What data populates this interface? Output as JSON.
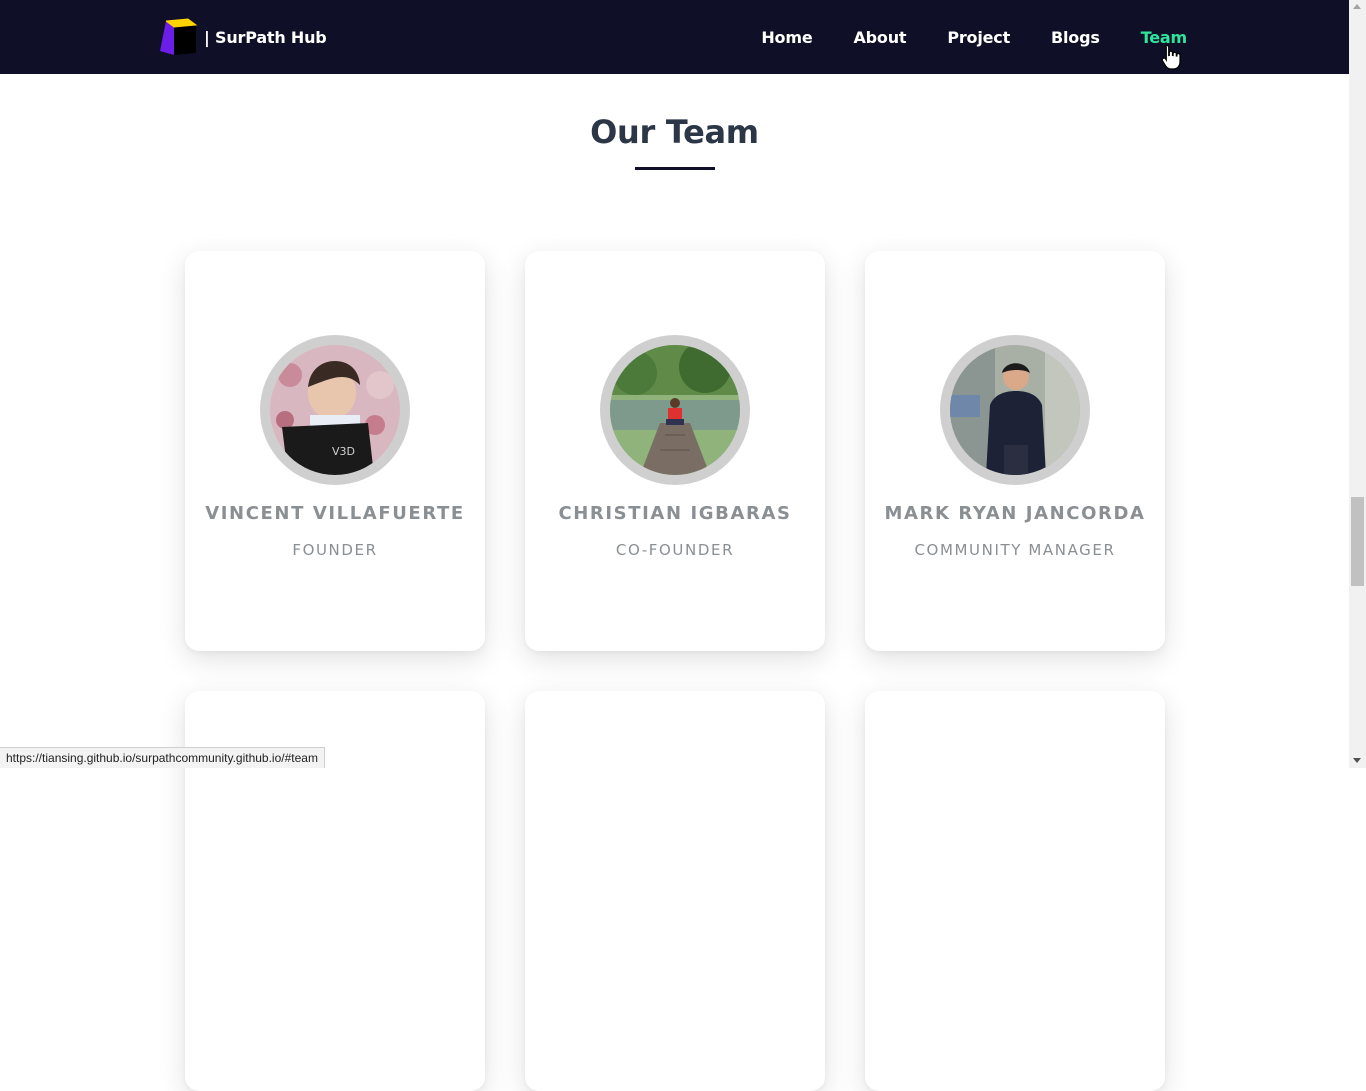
{
  "nav": {
    "brand": "| SurPath Hub",
    "links": [
      {
        "label": "Home"
      },
      {
        "label": "About"
      },
      {
        "label": "Project"
      },
      {
        "label": "Blogs"
      },
      {
        "label": "Team",
        "active": true
      }
    ]
  },
  "section": {
    "title": "Our Team"
  },
  "team": [
    {
      "name": "VINCENT VILLAFUERTE",
      "role": "FOUNDER",
      "photo": "avatar-photo-1"
    },
    {
      "name": "CHRISTIAN IGBARAS",
      "role": "CO-FOUNDER",
      "photo": "avatar-photo-2"
    },
    {
      "name": "MARK RYAN JANCORDA",
      "role": "COMMUNITY MANAGER",
      "photo": "avatar-photo-3"
    }
  ],
  "status_bar": {
    "url": "https://tiansing.github.io/surpathcommunity.github.io/#team"
  },
  "colors": {
    "nav_bg": "#0f1027",
    "active_link": "#2ee59d",
    "title": "#2b3646",
    "member_text": "#8a8f94"
  }
}
